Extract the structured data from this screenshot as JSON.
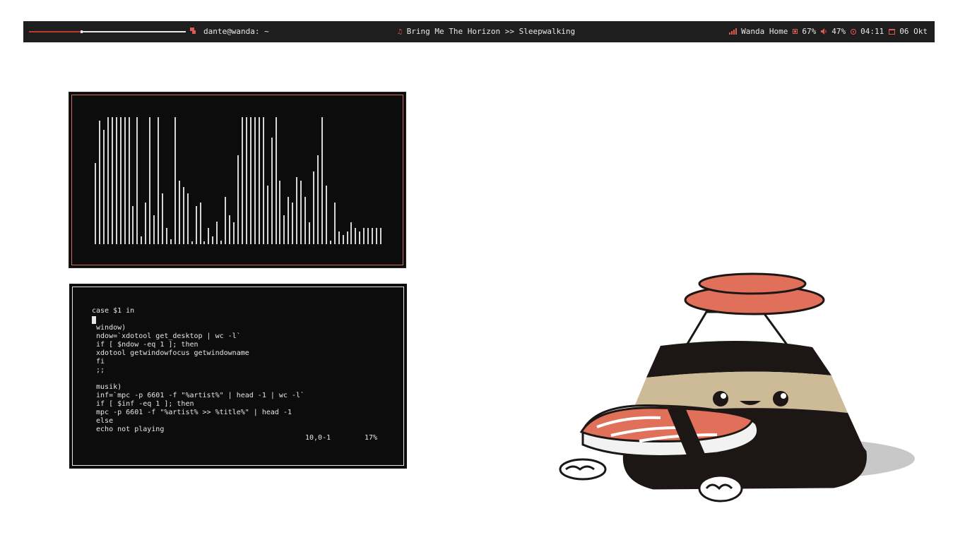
{
  "panel": {
    "music_progress": 0.33,
    "terminal_icon": "terminal-icon",
    "user_host": "dante@wanda: ~",
    "music_icon": "♫",
    "now_playing": "Bring Me The Horizon >> Sleepwalking",
    "wifi_label": "Wanda Home",
    "battery_percent": "67%",
    "volume_percent": "47%",
    "time": "04:11",
    "date": "06 Okt",
    "accent_color": "#e05a4f",
    "bg_color": "#1e1e1e"
  },
  "visualizer": {
    "bar_color": "#d6d6d6",
    "border_color": "#d26d63",
    "levels": [
      0.64,
      0.97,
      0.9,
      1,
      1,
      1,
      1,
      1,
      1,
      0.3,
      1,
      0.06,
      0.33,
      1,
      0.23,
      1,
      0.4,
      0.13,
      0.04,
      1,
      0.5,
      0.45,
      0.4,
      0.02,
      0.3,
      0.33,
      0.02,
      0.13,
      0.06,
      0.18,
      0.03,
      0.37,
      0.23,
      0.17,
      0.7,
      1,
      1,
      1,
      1,
      1,
      1,
      0.46,
      0.84,
      1,
      0.5,
      0.23,
      0.37,
      0.33,
      0.53,
      0.5,
      0.37,
      0.17,
      0.57,
      0.7,
      1,
      0.46,
      0.03,
      0.33,
      0.1,
      0.07,
      0.1,
      0.17,
      0.13,
      0.1,
      0.13,
      0.13,
      0.13,
      0.13,
      0.13
    ]
  },
  "editor": {
    "lines": [
      "case $1 in",
      "",
      " window)",
      " ndow=`xdotool get_desktop | wc -l`",
      " if [ $ndow -eq 1 ]; then",
      " xdotool getwindowfocus getwindowname",
      " fi",
      " ;;",
      "",
      " musik)",
      " inf=`mpc -p 6601 -f \"%artist%\" | head -1 | wc -l`",
      " if [ $inf -eq 1 ]; then",
      " mpc -p 6601 -f \"%artist% >> %title%\" | head -1",
      " else",
      " echo not playing"
    ],
    "ruler_position": "10,0-1",
    "ruler_percent": "17%"
  },
  "wallpaper": {
    "subject": "soy-sauce-bottle-hugging-sushi",
    "colors": {
      "salmon": "#e0705a",
      "sauce": "#1c1615",
      "tan": "#cdbb97",
      "rice": "#f2f2f2"
    }
  }
}
